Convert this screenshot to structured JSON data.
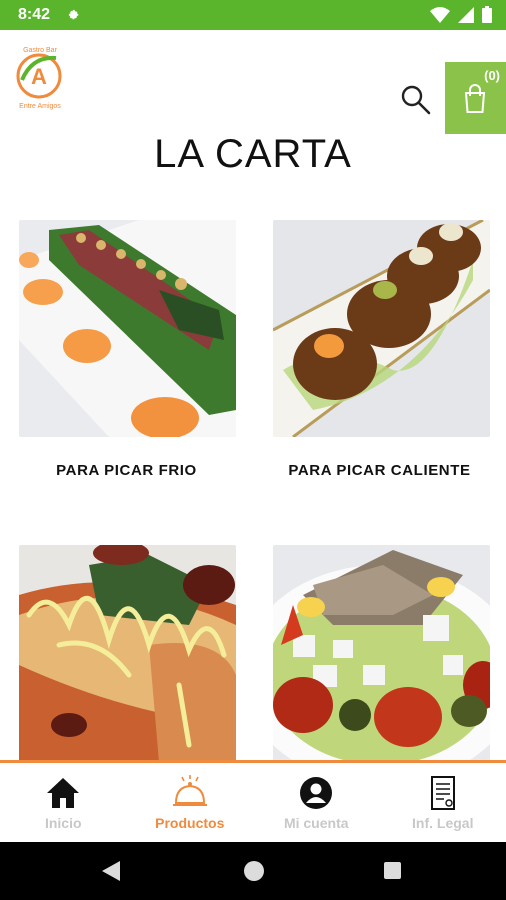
{
  "status_bar": {
    "time": "8:42",
    "icons": [
      "gear-icon",
      "wifi-icon",
      "signal-icon",
      "battery-icon"
    ],
    "background": "#5ab52c"
  },
  "header": {
    "logo_text": [
      "Gastro Bar",
      "Entre Amigos"
    ],
    "cart_count": "(0)",
    "cart_bg": "#8bc34a"
  },
  "page": {
    "title": "LA CARTA"
  },
  "categories": [
    {
      "label": "PARA PICAR FRIO",
      "image": "tuna-tataki-photo"
    },
    {
      "label": "PARA PICAR CALIENTE",
      "image": "croquettes-photo"
    },
    {
      "label": "",
      "image": "flatbread-toast-photo"
    },
    {
      "label": "",
      "image": "tuna-salad-photo"
    }
  ],
  "bottom_nav": {
    "items": [
      {
        "label": "Inicio",
        "icon": "home-icon"
      },
      {
        "label": "Productos",
        "icon": "cloche-icon",
        "active": true
      },
      {
        "label": "Mi cuenta",
        "icon": "account-icon"
      },
      {
        "label": "Inf. Legal",
        "icon": "document-icon"
      }
    ],
    "accent": "#f08a3c"
  }
}
